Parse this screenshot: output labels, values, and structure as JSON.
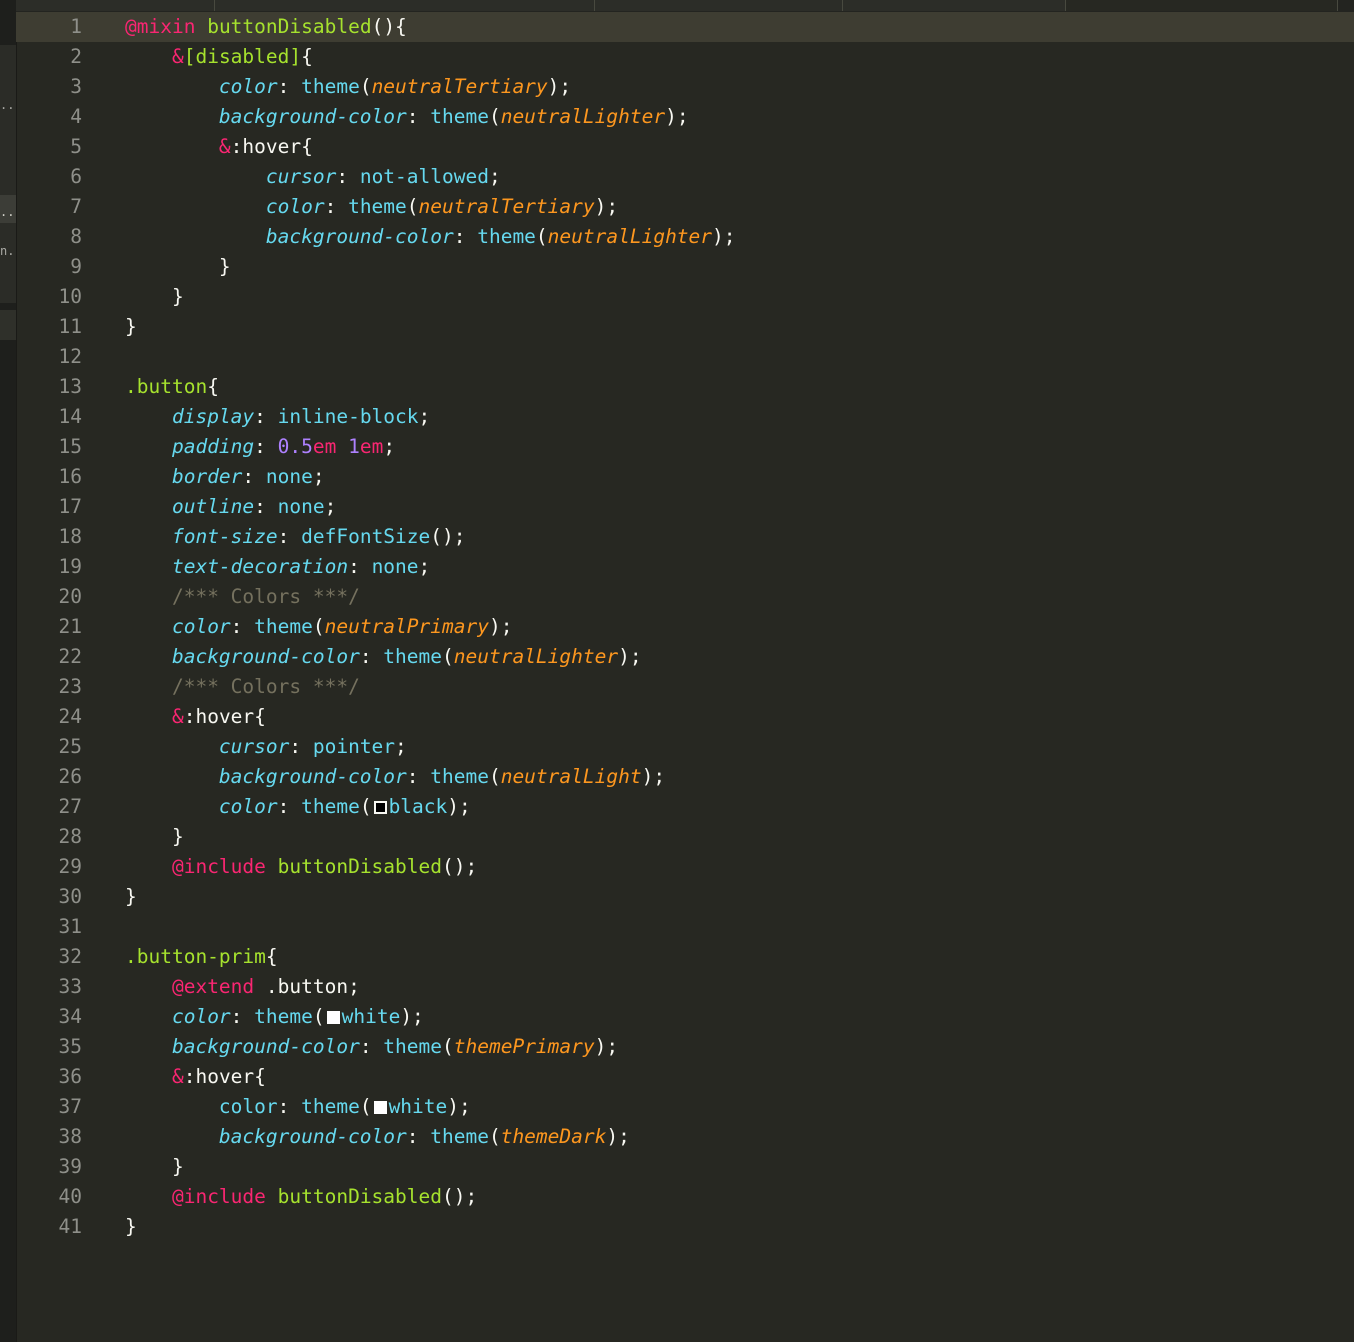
{
  "sidebar": {
    "items": [
      {
        "label": "..."
      },
      {
        "label": "..."
      },
      {
        "label": "n..."
      }
    ]
  },
  "tabs": [
    {
      "label": ""
    },
    {
      "label": ""
    },
    {
      "label": ""
    },
    {
      "label": ""
    },
    {
      "label": ""
    }
  ],
  "lines": [
    {
      "n": "1",
      "t": [
        [
          "at",
          "@mixin"
        ],
        [
          "pn",
          " "
        ],
        [
          "fn",
          "buttonDisabled"
        ],
        [
          "pn",
          "(){"
        ]
      ]
    },
    {
      "n": "2",
      "t": [
        [
          "pn",
          "    "
        ],
        [
          "at",
          "&"
        ],
        [
          "fn",
          "[disabled]"
        ],
        [
          "pn",
          "{"
        ]
      ]
    },
    {
      "n": "3",
      "t": [
        [
          "pn",
          "        "
        ],
        [
          "prop",
          "color"
        ],
        [
          "pn",
          ": "
        ],
        [
          "val",
          "theme"
        ],
        [
          "pn",
          "("
        ],
        [
          "arg",
          "neutralTertiary"
        ],
        [
          "pn",
          ");"
        ]
      ]
    },
    {
      "n": "4",
      "t": [
        [
          "pn",
          "        "
        ],
        [
          "prop",
          "background-color"
        ],
        [
          "pn",
          ": "
        ],
        [
          "val",
          "theme"
        ],
        [
          "pn",
          "("
        ],
        [
          "arg",
          "neutralLighter"
        ],
        [
          "pn",
          ");"
        ]
      ]
    },
    {
      "n": "5",
      "t": [
        [
          "pn",
          "        "
        ],
        [
          "at",
          "&"
        ],
        [
          "pn",
          ":hover{"
        ]
      ]
    },
    {
      "n": "6",
      "t": [
        [
          "pn",
          "            "
        ],
        [
          "prop",
          "cursor"
        ],
        [
          "pn",
          ": "
        ],
        [
          "val",
          "not-allowed"
        ],
        [
          "pn",
          ";"
        ]
      ]
    },
    {
      "n": "7",
      "t": [
        [
          "pn",
          "            "
        ],
        [
          "prop",
          "color"
        ],
        [
          "pn",
          ": "
        ],
        [
          "val",
          "theme"
        ],
        [
          "pn",
          "("
        ],
        [
          "arg",
          "neutralTertiary"
        ],
        [
          "pn",
          ");"
        ]
      ]
    },
    {
      "n": "8",
      "t": [
        [
          "pn",
          "            "
        ],
        [
          "prop",
          "background-color"
        ],
        [
          "pn",
          ": "
        ],
        [
          "val",
          "theme"
        ],
        [
          "pn",
          "("
        ],
        [
          "arg",
          "neutralLighter"
        ],
        [
          "pn",
          ");"
        ]
      ]
    },
    {
      "n": "9",
      "t": [
        [
          "pn",
          "        }"
        ]
      ]
    },
    {
      "n": "10",
      "t": [
        [
          "pn",
          "    }"
        ]
      ]
    },
    {
      "n": "11",
      "t": [
        [
          "pn",
          "}"
        ]
      ]
    },
    {
      "n": "12",
      "t": []
    },
    {
      "n": "13",
      "t": [
        [
          "sel",
          ".button"
        ],
        [
          "pn",
          "{"
        ]
      ]
    },
    {
      "n": "14",
      "t": [
        [
          "pn",
          "    "
        ],
        [
          "prop",
          "display"
        ],
        [
          "pn",
          ": "
        ],
        [
          "val",
          "inline-block"
        ],
        [
          "pn",
          ";"
        ]
      ]
    },
    {
      "n": "15",
      "t": [
        [
          "pn",
          "    "
        ],
        [
          "prop",
          "padding"
        ],
        [
          "pn",
          ": "
        ],
        [
          "num",
          "0.5"
        ],
        [
          "unit",
          "em"
        ],
        [
          "pn",
          " "
        ],
        [
          "num",
          "1"
        ],
        [
          "unit",
          "em"
        ],
        [
          "pn",
          ";"
        ]
      ]
    },
    {
      "n": "16",
      "t": [
        [
          "pn",
          "    "
        ],
        [
          "prop",
          "border"
        ],
        [
          "pn",
          ": "
        ],
        [
          "val",
          "none"
        ],
        [
          "pn",
          ";"
        ]
      ]
    },
    {
      "n": "17",
      "t": [
        [
          "pn",
          "    "
        ],
        [
          "prop",
          "outline"
        ],
        [
          "pn",
          ": "
        ],
        [
          "val",
          "none"
        ],
        [
          "pn",
          ";"
        ]
      ]
    },
    {
      "n": "18",
      "t": [
        [
          "pn",
          "    "
        ],
        [
          "prop",
          "font-size"
        ],
        [
          "pn",
          ": "
        ],
        [
          "val",
          "defFontSize"
        ],
        [
          "pn",
          "();"
        ]
      ]
    },
    {
      "n": "19",
      "t": [
        [
          "pn",
          "    "
        ],
        [
          "prop",
          "text-decoration"
        ],
        [
          "pn",
          ": "
        ],
        [
          "val",
          "none"
        ],
        [
          "pn",
          ";"
        ]
      ]
    },
    {
      "n": "20",
      "t": [
        [
          "pn",
          "    "
        ],
        [
          "cm",
          "/*** Colors ***/"
        ]
      ]
    },
    {
      "n": "21",
      "t": [
        [
          "pn",
          "    "
        ],
        [
          "prop",
          "color"
        ],
        [
          "pn",
          ": "
        ],
        [
          "val",
          "theme"
        ],
        [
          "pn",
          "("
        ],
        [
          "arg",
          "neutralPrimary"
        ],
        [
          "pn",
          ");"
        ]
      ]
    },
    {
      "n": "22",
      "t": [
        [
          "pn",
          "    "
        ],
        [
          "prop",
          "background-color"
        ],
        [
          "pn",
          ": "
        ],
        [
          "val",
          "theme"
        ],
        [
          "pn",
          "("
        ],
        [
          "arg",
          "neutralLighter"
        ],
        [
          "pn",
          ");"
        ]
      ]
    },
    {
      "n": "23",
      "t": [
        [
          "pn",
          "    "
        ],
        [
          "cm",
          "/*** Colors ***/"
        ]
      ]
    },
    {
      "n": "24",
      "t": [
        [
          "pn",
          "    "
        ],
        [
          "at",
          "&"
        ],
        [
          "pn",
          ":hover{"
        ]
      ]
    },
    {
      "n": "25",
      "t": [
        [
          "pn",
          "        "
        ],
        [
          "prop",
          "cursor"
        ],
        [
          "pn",
          ": "
        ],
        [
          "val",
          "pointer"
        ],
        [
          "pn",
          ";"
        ]
      ]
    },
    {
      "n": "26",
      "t": [
        [
          "pn",
          "        "
        ],
        [
          "prop",
          "background-color"
        ],
        [
          "pn",
          ": "
        ],
        [
          "val",
          "theme"
        ],
        [
          "pn",
          "("
        ],
        [
          "arg",
          "neutralLight"
        ],
        [
          "pn",
          ");"
        ]
      ]
    },
    {
      "n": "27",
      "t": [
        [
          "pn",
          "        "
        ],
        [
          "prop",
          "color"
        ],
        [
          "pn",
          ": "
        ],
        [
          "val",
          "theme"
        ],
        [
          "pn",
          "("
        ],
        [
          "swatch",
          "black"
        ],
        [
          "val",
          "black"
        ],
        [
          "pn",
          ");"
        ]
      ]
    },
    {
      "n": "28",
      "t": [
        [
          "pn",
          "    }"
        ]
      ]
    },
    {
      "n": "29",
      "t": [
        [
          "pn",
          "    "
        ],
        [
          "at",
          "@include"
        ],
        [
          "pn",
          " "
        ],
        [
          "fn",
          "buttonDisabled"
        ],
        [
          "pn",
          "();"
        ]
      ]
    },
    {
      "n": "30",
      "t": [
        [
          "pn",
          "}"
        ]
      ]
    },
    {
      "n": "31",
      "t": []
    },
    {
      "n": "32",
      "t": [
        [
          "sel",
          ".button-prim"
        ],
        [
          "pn",
          "{"
        ]
      ]
    },
    {
      "n": "33",
      "t": [
        [
          "pn",
          "    "
        ],
        [
          "at",
          "@extend"
        ],
        [
          "pn",
          " .button;"
        ]
      ]
    },
    {
      "n": "34",
      "t": [
        [
          "pn",
          "    "
        ],
        [
          "prop",
          "color"
        ],
        [
          "pn",
          ": "
        ],
        [
          "val",
          "theme"
        ],
        [
          "pn",
          "("
        ],
        [
          "swatch",
          "white"
        ],
        [
          "val",
          "white"
        ],
        [
          "pn",
          ");"
        ]
      ]
    },
    {
      "n": "35",
      "t": [
        [
          "pn",
          "    "
        ],
        [
          "prop",
          "background-color"
        ],
        [
          "pn",
          ": "
        ],
        [
          "val",
          "theme"
        ],
        [
          "pn",
          "("
        ],
        [
          "arg",
          "themePrimary"
        ],
        [
          "pn",
          ");"
        ]
      ]
    },
    {
      "n": "36",
      "t": [
        [
          "pn",
          "    "
        ],
        [
          "at",
          "&"
        ],
        [
          "pn",
          ":hover{"
        ]
      ]
    },
    {
      "n": "37",
      "t": [
        [
          "pn",
          "        "
        ],
        [
          "prop-n",
          "color"
        ],
        [
          "pn",
          ": "
        ],
        [
          "val",
          "theme"
        ],
        [
          "pn",
          "("
        ],
        [
          "swatch",
          "white"
        ],
        [
          "val",
          "white"
        ],
        [
          "pn",
          ");"
        ]
      ]
    },
    {
      "n": "38",
      "t": [
        [
          "pn",
          "        "
        ],
        [
          "prop",
          "background-color"
        ],
        [
          "pn",
          ": "
        ],
        [
          "val",
          "theme"
        ],
        [
          "pn",
          "("
        ],
        [
          "arg",
          "themeDark"
        ],
        [
          "pn",
          ");"
        ]
      ]
    },
    {
      "n": "39",
      "t": [
        [
          "pn",
          "    }"
        ]
      ]
    },
    {
      "n": "40",
      "t": [
        [
          "pn",
          "    "
        ],
        [
          "at",
          "@include"
        ],
        [
          "pn",
          " "
        ],
        [
          "fn",
          "buttonDisabled"
        ],
        [
          "pn",
          "();"
        ]
      ]
    },
    {
      "n": "41",
      "t": [
        [
          "pn",
          "}"
        ]
      ]
    }
  ],
  "current_line": "1",
  "theme_colors": {
    "background": "#272822",
    "keyword": "#f92672",
    "function": "#a6e22e",
    "property": "#66d9ef",
    "argument": "#fd971f",
    "number": "#ae81ff",
    "comment": "#75715e",
    "text": "#f8f8f2"
  }
}
